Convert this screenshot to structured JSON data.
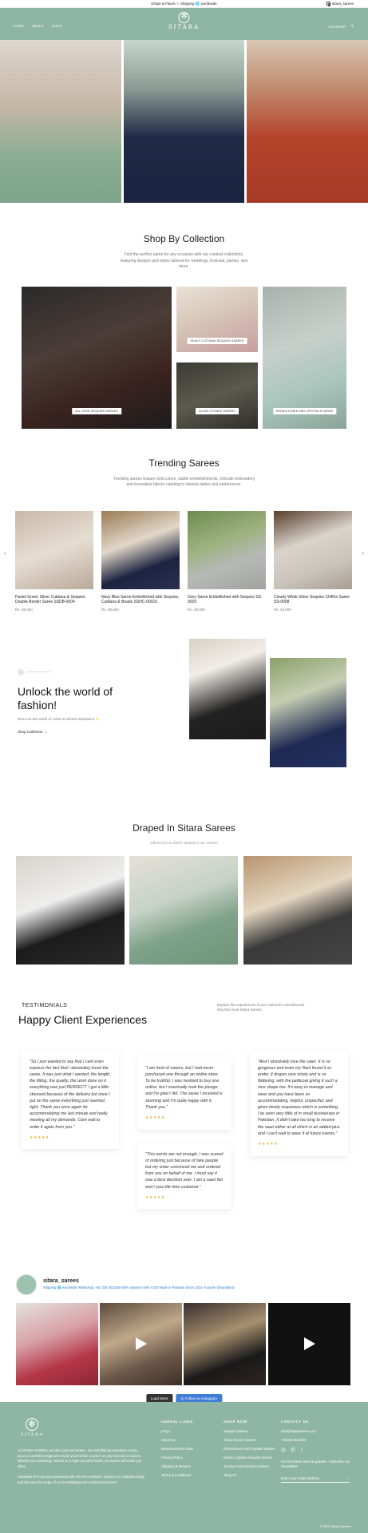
{
  "topbar": {
    "announcement": "Drape & Flaunt ✧ Shipping 🌐 worldwide",
    "instagram_handle": "sitara_sarees"
  },
  "nav": {
    "links": [
      "HOME",
      "ABOUT",
      "SHOP"
    ],
    "brand": "SITARA",
    "account_label": "ACCOUNT"
  },
  "collection": {
    "title": "Shop By Collection",
    "subtitle": "Find the perfect saree for any occasion with our curated collections, featuring designs and styles tailored for weddings, festivals, parties, and more.",
    "tiles": [
      "ALL OVER SEQUINS SAREES",
      "HEAVY CUTDANA SEQUINS SAREES",
      "GLASS STONES SAREES",
      "RHINESTONES AND CRYSTALS SAREE"
    ]
  },
  "trending": {
    "title": "Trending Sarees",
    "subtitle": "Trending sarees feature bold colors, subtle embellishments, intricate embroidery and innovative fabrics catering to diverse tastes and preferences.",
    "products": [
      {
        "name": "Pastel Green Silver Cutdana & Sequins Double Border Saree SSDB-0004",
        "price": "Rs. 36,000"
      },
      {
        "name": "Navy Blue Saree Embellished with Sequins, Cutdana & Beads SSHC-00010",
        "price": "Rs. 58,500"
      },
      {
        "name": "Grey Saree Embellished with Sequins SS-0025",
        "price": "Rs. 38,000"
      },
      {
        "name": "Cloudy White Silver Sequins Chiffon Saree SS-0008",
        "price": "Rs. 34,000"
      }
    ]
  },
  "unlock": {
    "title": "Unlock the world of fashion!",
    "description": "Dive into the world of colors & vibrant transitions ✨",
    "cta": "Shop Collection"
  },
  "draped": {
    "title": "Draped In Sitara Sarees",
    "subtitle": "Influencers & clients spotted in our sarees!"
  },
  "testimonials": {
    "kicker": "TESTIMONIALS",
    "title": "Happy Client Experiences",
    "aside": "Explore the experiences of our customers and discover why they love Sitara Sarees.",
    "stars": "★★★★★",
    "quotes": [
      "\"So I just wanted to say that I cant even express the fact that I absolutely loved the saree. It was just what I wanted, the length, the fitting, the quality, the work done on it everything was just PERFECT. I got a little stressed because of the delivery but once I put on the saree everything just seemed right. Thank you once again for accommodating me last minute and really meeting all my demands. Cant wait to order it again from you.\"",
      "\"I am fond of sarees, but I had never purchased one through an online store. To be truthful, I was hesitant to buy one online, but I eventually took the plunge and I'm glad I did. The saree I received is stunning and I'm quite happy with it. Thank you.\"",
      "\"This words are not enough, I was scared of ordering just because of fake people but my sister convinced me and ordered from you on behalf of me. I must say it was a best decision ever. I am a saari fan and I your life time customer.\"",
      "\"And I absolutely love the saari. It is so gorgeous and even my Nani found it so pretty. It drapes very nicely and is so flattering, with the petticoat giving it such a nice shape too. It's easy to manage and wear and you have been so accommodating, helpful, respectful, and given timely responses which is something I've seen very little of in small businesses in Pakistan. It didn't take too long to receive the saari either at all which is an added plus and I can't wait to wear it at future events.\""
    ]
  },
  "instagram": {
    "username": "sitara_sarees",
    "bio": "Shipping 🌐 worldwide WhatsApp: +92 334 4011508 50% advance 50% COD Made in Pakistan Since 2021 Founder @sanafarid",
    "load_more": "Load More",
    "follow": "Follow on Instagram"
  },
  "footer": {
    "brand": "SITARA",
    "about": "At SITARA SAREES, we don't just sell sarees - we craft lifelong memories. Every piece is carefully designed to make you feel like a queen on your special occasions. Whether it's a wedding, festival, or a night out with friends, our sarees will make you shine.",
    "about2": "Celebrate life's precious moments with SITARA SAREES. Explore our collection today and discover the magic of our breathtaking and sentimental sarees!",
    "useful_links_title": "USEFUL LINKS",
    "useful_links": [
      "FAQs",
      "About Us",
      "Measurements Chart",
      "Privacy Policy",
      "Shipping & Returns",
      "Terms & Conditions"
    ],
    "shop_now_title": "SHOP NOW",
    "shop_now": [
      "Sequins Sarees",
      "Glass Stones Sarees",
      "Rhinestones And Crystals Sarees",
      "Heavy Cutdana Sequins Sarees",
      "Tie Dye Front Borders Sarees",
      "Shop All"
    ],
    "contact_title": "CONTACT US",
    "email": "info@sitarasarees.com",
    "phone": "+923344011508",
    "newsletter": "Get the latest news & updates. Subscribe our Newsletter!",
    "email_placeholder": "Enter your email address",
    "copyright": "© 2025 Sitara Sarees"
  },
  "colors": {
    "brand": "#8fb6a4",
    "star": "#e3b341",
    "link": "#2c77d2"
  }
}
